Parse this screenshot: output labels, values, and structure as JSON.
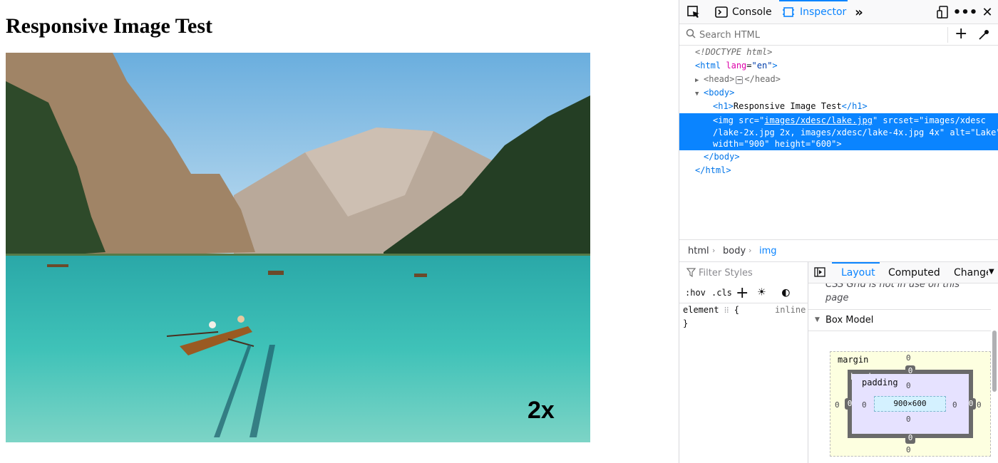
{
  "page": {
    "heading": "Responsive Image Test",
    "image_alt": "Lake",
    "image_overlay_text": "2x"
  },
  "devtools": {
    "toolbar": {
      "picker_icon": "element-picker-icon",
      "console_tab": "Console",
      "inspector_tab": "Inspector",
      "more_tabs_icon": "double-chevron-icon",
      "responsive_icon": "responsive-design-icon",
      "menu_icon": "more-icon",
      "close_icon": "close-icon"
    },
    "search": {
      "placeholder": "Search HTML",
      "add_icon": "plus-icon",
      "eyedropper_icon": "eyedropper-icon"
    },
    "markup": {
      "doctype": "<!DOCTYPE html>",
      "html_open": {
        "tag": "html",
        "attr": "lang",
        "value": "\"en\""
      },
      "head": {
        "open": "<head>",
        "ellipsis": "⋯",
        "close": "</head>"
      },
      "body_open": "<body>",
      "h1": {
        "open": "<h1>",
        "text": "Responsive Image Test",
        "close": "</h1>"
      },
      "img": {
        "line1_prefix": "<img src=\"",
        "src": "images/xdesc/lake.jpg",
        "line1_suffix": "\" srcset=\"images/xdesc",
        "line2": "/lake-2x.jpg 2x, images/xdesc/lake-4x.jpg 4x\" alt=\"Lake\"",
        "line3": "width=\"900\" height=\"600\">"
      },
      "body_close": "</body>",
      "html_close": "</html>"
    },
    "breadcrumbs": [
      "html",
      "body",
      "img"
    ],
    "rules": {
      "filter_placeholder": "Filter Styles",
      "hov": ":hov",
      "cls": ".cls",
      "element_selector": "element",
      "brace_open": "{",
      "inline_label": "inline",
      "brace_close": "}"
    },
    "layout": {
      "tabs": [
        "Layout",
        "Computed",
        "Changes"
      ],
      "grid_note": "CSS Grid is not in use on this page",
      "box_model_label": "Box Model",
      "box": {
        "margin_label": "margin",
        "border_label": "border",
        "padding_label": "padding",
        "content_size": "900×600",
        "margin_top": "0",
        "margin_bottom": "0",
        "margin_left": "0",
        "margin_right": "0",
        "border_top": "0",
        "border_bottom": "0",
        "border_left": "0",
        "border_right": "0",
        "padding_top": "0",
        "padding_bottom": "0",
        "padding_left": "0",
        "padding_right": "0"
      }
    }
  },
  "colors": {
    "accent": "#0a84ff",
    "selected_row": "#0a84ff",
    "tag": "#0074e8",
    "attr": "#dd00a9"
  }
}
